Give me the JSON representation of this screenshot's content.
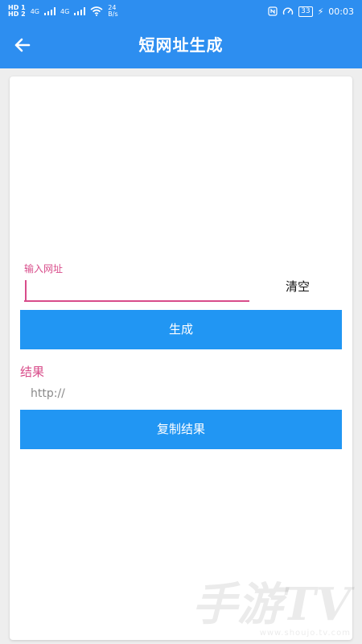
{
  "status_bar": {
    "sim1": "HD 1",
    "sim2": "HD 2",
    "net1": "4G",
    "net2": "4G",
    "speed_value": "24",
    "speed_unit": "B/s",
    "battery": "33",
    "time": "00:03"
  },
  "toolbar": {
    "title": "短网址生成",
    "back_icon": "arrow-left-icon"
  },
  "form": {
    "input_label": "输入网址",
    "input_value": "",
    "clear_label": "清空",
    "generate_label": "生成"
  },
  "result": {
    "label": "结果",
    "value": "http://",
    "copy_label": "复制结果"
  },
  "watermark": {
    "brand": "手游TV",
    "url": "www.shoujo.tv.com"
  },
  "colors": {
    "primary": "#2d8ef0",
    "button": "#2196f3",
    "accent": "#d84c8a"
  }
}
